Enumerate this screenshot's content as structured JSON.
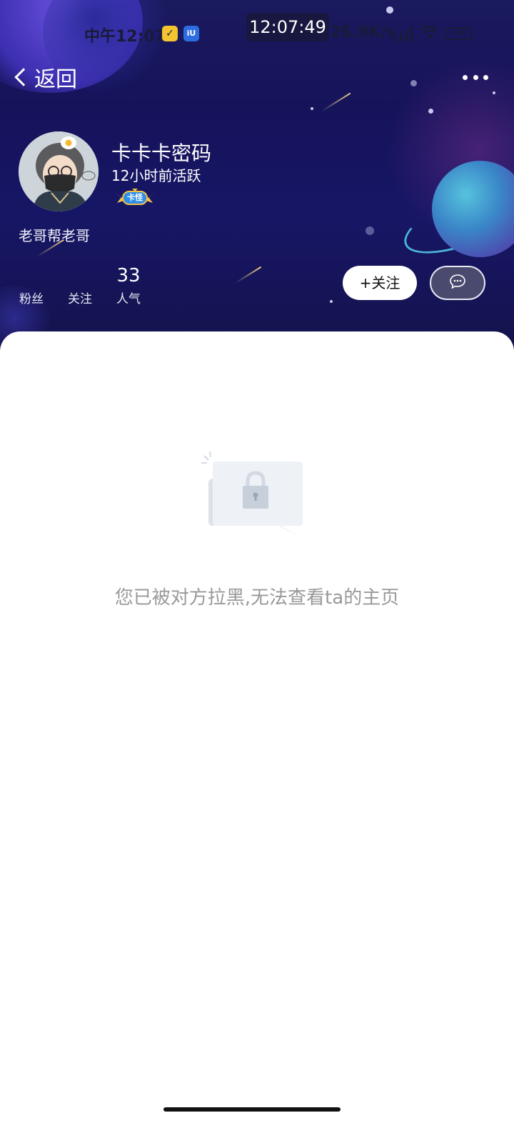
{
  "status_bar": {
    "time_left": "中午12:07",
    "center_time": "12:07:49",
    "net_speed": "26.9K/s",
    "battery": "100",
    "app_icon_text": "iU"
  },
  "nav": {
    "back_label": "返回",
    "more_icon": "more-dots-icon"
  },
  "profile": {
    "username": "卡卡卡密码",
    "active_status": "12小时前活跃",
    "badge_text": "卡怪",
    "signature": "老哥帮老哥",
    "stats": [
      {
        "label": "粉丝",
        "value": ""
      },
      {
        "label": "关注",
        "value": ""
      },
      {
        "label": "人气",
        "value": "33"
      }
    ],
    "follow_label": "+关注",
    "message_icon": "chat-bubble-icon"
  },
  "content": {
    "blocked_message": "您已被对方拉黑,无法查看ta的主页",
    "illustration_icon": "lock-icon"
  },
  "colors": {
    "header_bg": "#15135a",
    "message_gray": "#999999",
    "follow_bg": "#ffffff",
    "planet_cyan": "#4bb6d6"
  }
}
